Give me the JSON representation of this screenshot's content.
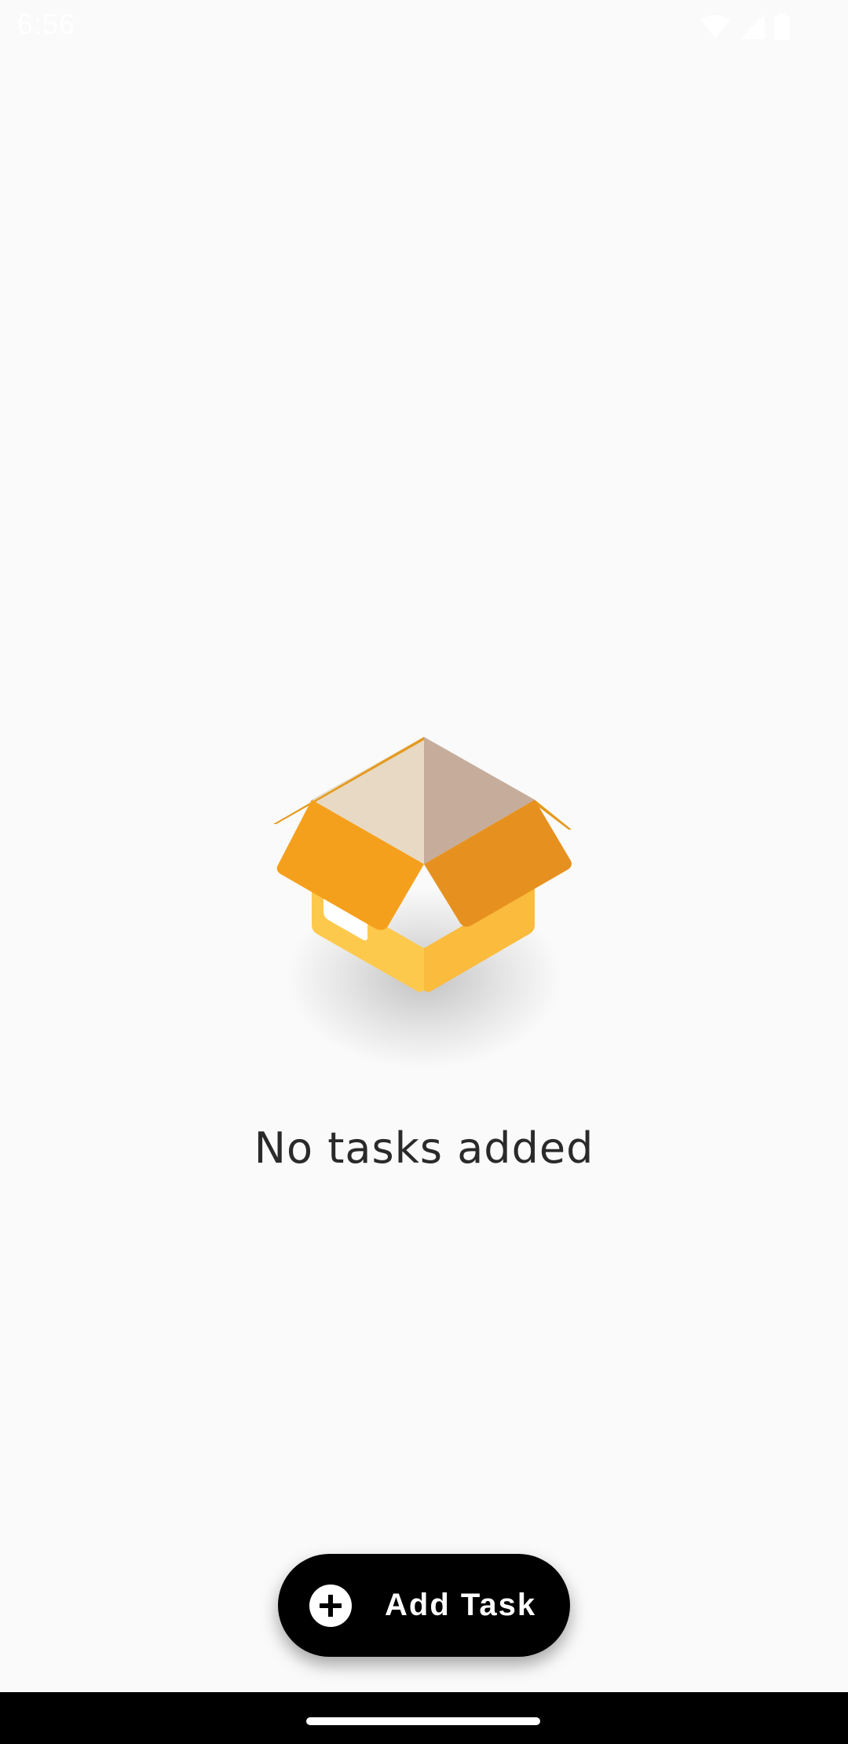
{
  "status_bar": {
    "time": "6:56",
    "icons": [
      "wifi-icon",
      "cell-signal-icon",
      "battery-icon"
    ]
  },
  "empty_state": {
    "illustration": "open-box-icon",
    "message": "No tasks added"
  },
  "fab": {
    "icon": "plus-circle-icon",
    "label": "Add Task"
  },
  "colors": {
    "background": "#fafafa",
    "fab_background": "#000000",
    "box_orange": "#f5a01c",
    "box_yellow": "#fdc94d",
    "box_inner": "#e7d9c4"
  }
}
